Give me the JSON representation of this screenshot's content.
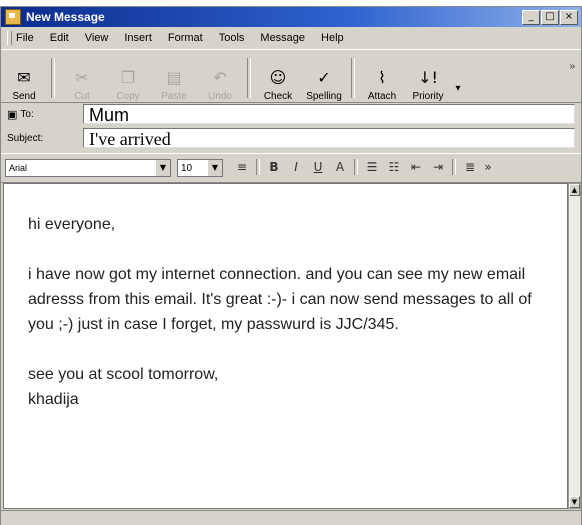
{
  "window": {
    "title": "New Message",
    "controls": {
      "minimize": "_",
      "maximize": "□",
      "close": "×"
    }
  },
  "menu": [
    "File",
    "Edit",
    "View",
    "Insert",
    "Format",
    "Tools",
    "Message",
    "Help"
  ],
  "toolbar": {
    "buttons": [
      {
        "label": "Send",
        "icon": "send-icon",
        "enabled": true
      },
      {
        "label": "Cut",
        "icon": "scissors-icon",
        "enabled": false
      },
      {
        "label": "Copy",
        "icon": "copy-icon",
        "enabled": false
      },
      {
        "label": "Paste",
        "icon": "paste-icon",
        "enabled": false
      },
      {
        "label": "Undo",
        "icon": "undo-icon",
        "enabled": false
      },
      {
        "label": "Check",
        "icon": "check-names-icon",
        "enabled": true
      },
      {
        "label": "Spelling",
        "icon": "spelling-icon",
        "enabled": true
      },
      {
        "label": "Attach",
        "icon": "paperclip-icon",
        "enabled": true
      },
      {
        "label": "Priority",
        "icon": "priority-icon",
        "enabled": true
      }
    ],
    "more": "»"
  },
  "header": {
    "to_label": "To:",
    "to_value": "Mum",
    "subject_label": "Subject:",
    "subject_value": "I've arrived"
  },
  "format": {
    "font": "Arial",
    "size": "10"
  },
  "body": {
    "line1": "hi everyone,",
    "para": "i have now got my internet connection. and you can see my new email adresss from this email. It's great :-)- i can now send messages to all of you ;-) just in case I forget, my passwurd is JJC/345.",
    "closing": "see you at scool tomorrow,",
    "signature": "khadija"
  }
}
